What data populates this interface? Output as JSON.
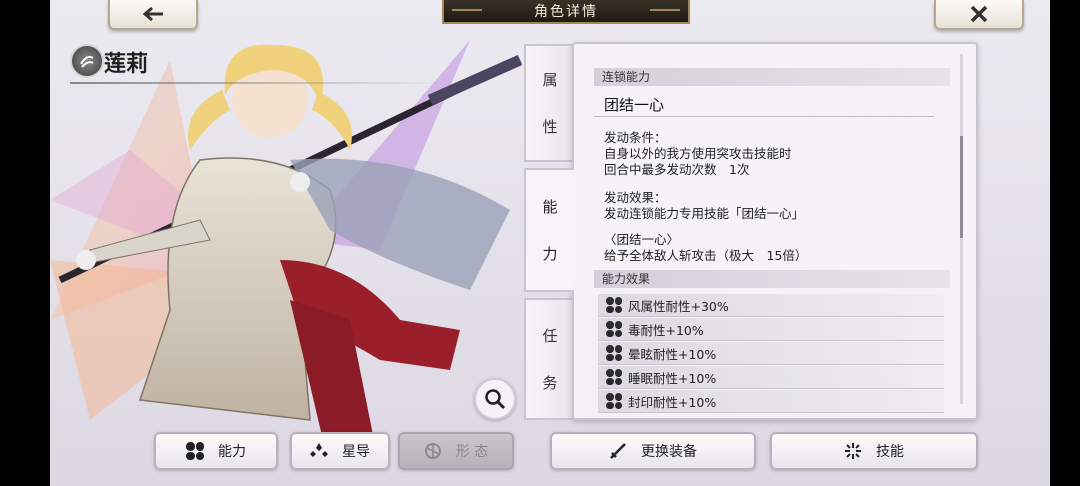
{
  "header": {
    "title": "角色详情",
    "back_icon": "back-arrow-icon",
    "close_icon": "close-x-icon"
  },
  "character": {
    "name": "莲莉",
    "element_icon": "wind-element-icon"
  },
  "side_tabs": [
    {
      "label_1": "属",
      "label_2": "性"
    },
    {
      "label_1": "能",
      "label_2": "力"
    },
    {
      "label_1": "任",
      "label_2": "务"
    }
  ],
  "chain_ability": {
    "header": "连锁能力",
    "name": "团结一心",
    "condition_title": "发动条件：",
    "condition_line1": "自身以外的我方使用突攻击技能时",
    "condition_line2": "回合中最多发动次数　1次",
    "effect_title": "发动效果：",
    "effect_line1": "发动连锁能力专用技能「团结一心」",
    "sub_title": "〈团结一心〉",
    "sub_line1": "给予全体敌人斩攻击（极大　15倍）"
  },
  "ability_effects": {
    "header": "能力效果",
    "items": [
      "风属性耐性+30%",
      "毒耐性+10%",
      "晕眩耐性+10%",
      "睡眠耐性+10%",
      "封印耐性+10%"
    ]
  },
  "bottom_buttons": {
    "ability": "能力",
    "star_guide": "星导",
    "form": "形 态",
    "change_equipment": "更换装备",
    "skill": "技能"
  },
  "colors": {
    "accent_gold": "#a08859",
    "panel_bg": "#f5f3f8",
    "title_bg": "#2b241b"
  }
}
